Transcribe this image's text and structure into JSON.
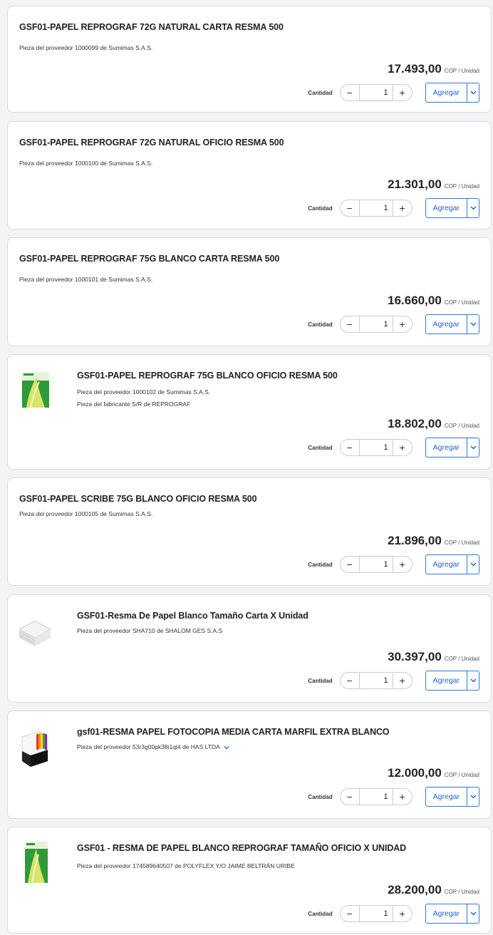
{
  "labels": {
    "quantity": "Cantidad",
    "add": "Agregar",
    "per_unit": "COP / Unidad",
    "minus": "−",
    "plus": "+"
  },
  "products": [
    {
      "title": "GSF01-PAPEL REPROGRAF 72G NATURAL CARTA RESMA 500",
      "supplier_label": "Pieza del proveedor",
      "supplier_part": "1000099",
      "de": "de",
      "supplier": "Sumimas S.A.S.",
      "price": "17.493,00",
      "qty": "1"
    },
    {
      "title": "GSF01-PAPEL REPROGRAF 72G NATURAL OFICIO RESMA 500",
      "supplier_label": "Pieza del proveedor",
      "supplier_part": "1000100",
      "de": "de",
      "supplier": "Sumimas S.A.S.",
      "price": "21.301,00",
      "qty": "1"
    },
    {
      "title": "GSF01-PAPEL REPROGRAF 75G BLANCO CARTA RESMA 500",
      "supplier_label": "Pieza del proveedor",
      "supplier_part": "1000101",
      "de": "de",
      "supplier": "Sumimas S.A.S.",
      "price": "16.660,00",
      "qty": "1"
    },
    {
      "title": "GSF01-PAPEL REPROGRAF 75G BLANCO OFICIO RESMA 500",
      "supplier_label": "Pieza del proveedor",
      "supplier_part": "1000102",
      "de": "de",
      "supplier": "Sumimas S.A.S.",
      "maker_label": "Pieza del fabricante",
      "maker_part": "S/R",
      "maker_de": "de",
      "maker": "REPROGRAF",
      "price": "18.802,00",
      "qty": "1"
    },
    {
      "title": "GSF01-PAPEL SCRIBE 75G BLANCO OFICIO RESMA 500",
      "supplier_label": "Pieza del proveedor",
      "supplier_part": "1000105",
      "de": "de",
      "supplier": "Sumimas S.A.S.",
      "price": "21.896,00",
      "qty": "1"
    },
    {
      "title": "GSF01-Resma De Papel Blanco Tamaño Carta X Unidad",
      "supplier_label": "Pieza del proveedor",
      "supplier_part": "SHA710",
      "de": "de",
      "supplier": "SHALOM GES S.A.S",
      "price": "30.397,00",
      "qty": "1"
    },
    {
      "title": "gsf01-RESMA PAPEL FOTOCOPIA MEDIA CARTA MARFIL EXTRA BLANCO",
      "supplier_label": "Pieza del proveedor",
      "supplier_part": "53r3g00pk38i1ql4",
      "de": "de",
      "supplier": "HAS LTDA",
      "price": "12.000,00",
      "qty": "1"
    },
    {
      "title": "GSF01 - RESMA DE PAPEL BLANCO REPROGRAF TAMAÑO OFICIO X UNIDAD",
      "supplier_label": "Pieza del proveedor",
      "supplier_part": "174589640507",
      "de": "de",
      "supplier": "POLYFLEX Y/O JAIME BELTRÁN URIBE",
      "price": "28.200,00",
      "qty": "1"
    }
  ],
  "colors": {
    "accent": "#2e7ad8",
    "border": "#d8dadf",
    "background": "#f2f3f5"
  },
  "icons": {
    "dropdown": "chevron-down-icon",
    "expand": "chevron-down-icon"
  }
}
